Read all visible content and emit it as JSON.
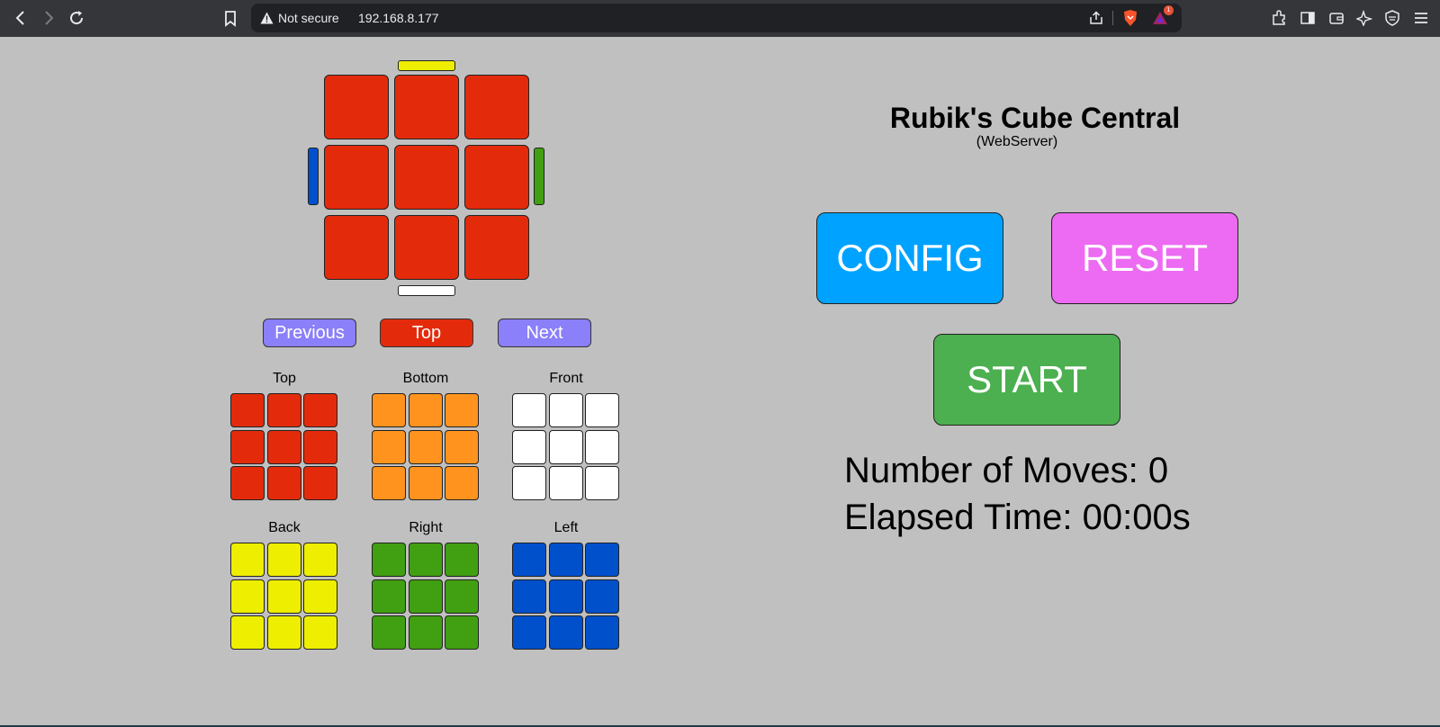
{
  "browser": {
    "not_secure_label": "Not secure",
    "url": "192.168.8.177",
    "extension_badge": "1"
  },
  "app": {
    "title": "Rubik's Cube Central",
    "subtitle": "(WebServer)"
  },
  "controls": {
    "config_label": "CONFIG",
    "reset_label": "RESET",
    "start_label": "START"
  },
  "face_nav": {
    "previous_label": "Previous",
    "current_label": "Top",
    "next_label": "Next"
  },
  "stats": {
    "moves_label": "Number of Moves:",
    "moves_value": "0",
    "time_label": "Elapsed Time:",
    "time_value": "00:00s"
  },
  "colors": {
    "red": "#e32b0c",
    "orange": "#ff931e",
    "white": "#ffffff",
    "yellow": "#eeee00",
    "green": "#419f12",
    "blue": "#0050cc",
    "config": "#00a2ff",
    "reset": "#ec6bf2",
    "start": "#4caf50",
    "nav": "#8b7ffa"
  },
  "main_face": {
    "stickers": [
      "red",
      "red",
      "red",
      "red",
      "red",
      "red",
      "red",
      "red",
      "red"
    ],
    "edge_top": "yellow",
    "edge_bottom": "white",
    "edge_left": "blue",
    "edge_right": "green"
  },
  "faces": [
    {
      "name": "Top",
      "stickers": [
        "red",
        "red",
        "red",
        "red",
        "red",
        "red",
        "red",
        "red",
        "red"
      ]
    },
    {
      "name": "Bottom",
      "stickers": [
        "orange",
        "orange",
        "orange",
        "orange",
        "orange",
        "orange",
        "orange",
        "orange",
        "orange"
      ]
    },
    {
      "name": "Front",
      "stickers": [
        "white",
        "white",
        "white",
        "white",
        "white",
        "white",
        "white",
        "white",
        "white"
      ]
    },
    {
      "name": "Back",
      "stickers": [
        "yellow",
        "yellow",
        "yellow",
        "yellow",
        "yellow",
        "yellow",
        "yellow",
        "yellow",
        "yellow"
      ]
    },
    {
      "name": "Right",
      "stickers": [
        "green",
        "green",
        "green",
        "green",
        "green",
        "green",
        "green",
        "green",
        "green"
      ]
    },
    {
      "name": "Left",
      "stickers": [
        "blue",
        "blue",
        "blue",
        "blue",
        "blue",
        "blue",
        "blue",
        "blue",
        "blue"
      ]
    }
  ]
}
